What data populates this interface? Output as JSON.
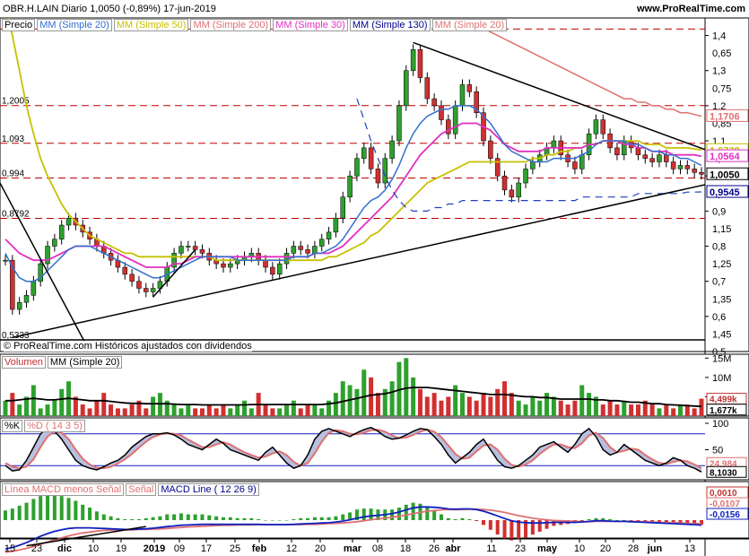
{
  "header": {
    "title": "OBR.H.LAIN  Diario  1,0050 (-0,89%)  17-jun-2019",
    "site": "www.ProRealTime.com"
  },
  "legend_price": [
    "Precio",
    "MM (Simple 20)",
    "MM (Simple 50)",
    "MM (Simple 200)",
    "MM (Simple 30)",
    "MM (Simple 130)",
    "MM (Simple 20)"
  ],
  "legend_colors": [
    "#000000",
    "#3070d0",
    "#c8c000",
    "#e07070",
    "#e030c0",
    "#00008b",
    "#e07070"
  ],
  "legend_volume": [
    "Volumen",
    "MM (Simple 20)"
  ],
  "legend_stoch": [
    "%K",
    "%D ( 14 3 5)"
  ],
  "legend_macd": [
    "Línea MACD menos Señal",
    "Señal",
    "MACD Line ( 12 26 9)"
  ],
  "credit": "© ProRealTime.com Históricos ajustados con dividendos",
  "chart_data": [
    {
      "type": "candlestick",
      "name": "price",
      "ylim": [
        0.5,
        1.45
      ],
      "y_ticks": [
        0.5,
        0.6,
        0.7,
        0.8,
        0.9,
        1.0,
        1.1,
        1.2,
        1.3,
        1.4
      ],
      "y_tick_labels": [
        "0,5",
        "0,6",
        "0,7",
        "0,8",
        "0,9",
        "1",
        "1,1",
        "1,2",
        "1,3",
        "1,4"
      ],
      "extra_labels": [
        "1,45",
        "1,35",
        "1,25",
        "1,15",
        "1,05",
        "0,95",
        "0,85",
        "0,75",
        "0,65",
        "0,55"
      ],
      "x_labels": [
        "15",
        "23",
        "dic",
        "10",
        "19",
        "2019",
        "09",
        "17",
        "25",
        "feb",
        "12",
        "20",
        "mar",
        "08",
        "18",
        "26",
        "abr",
        "11",
        "23",
        "may",
        "10",
        "20",
        "28",
        "jun",
        "13"
      ],
      "hlines": [
        {
          "value": 1.4185,
          "label": "1,4185"
        },
        {
          "value": 1.2005,
          "label": "1,2005"
        },
        {
          "value": 1.093,
          "label": "1,093"
        },
        {
          "value": 0.994,
          "label": "0,994"
        },
        {
          "value": 0.8792,
          "label": "0,8792"
        },
        {
          "value": 0.5333,
          "label": "0,5333"
        }
      ],
      "badges": [
        {
          "value": 1.1706,
          "label": "1,1706",
          "color": "#e07070"
        },
        {
          "value": 1.0738,
          "label": "1,0738",
          "color": "#c8c000"
        },
        {
          "value": 1.0564,
          "label": "1,0564",
          "color": "#e030c0"
        },
        {
          "value": 1.005,
          "label": "1,0050",
          "color": "#000000"
        },
        {
          "value": 0.9545,
          "label": "0,9545",
          "color": "#00008b"
        }
      ],
      "close": [
        0.76,
        0.62,
        0.64,
        0.66,
        0.7,
        0.75,
        0.8,
        0.82,
        0.86,
        0.88,
        0.86,
        0.84,
        0.82,
        0.8,
        0.78,
        0.76,
        0.74,
        0.72,
        0.7,
        0.68,
        0.67,
        0.68,
        0.7,
        0.74,
        0.78,
        0.8,
        0.8,
        0.79,
        0.78,
        0.76,
        0.75,
        0.74,
        0.75,
        0.76,
        0.77,
        0.78,
        0.76,
        0.74,
        0.72,
        0.75,
        0.78,
        0.8,
        0.79,
        0.78,
        0.8,
        0.82,
        0.84,
        0.88,
        0.94,
        1.0,
        1.05,
        1.08,
        1.02,
        0.98,
        1.05,
        1.1,
        1.2,
        1.3,
        1.36,
        1.28,
        1.22,
        1.2,
        1.16,
        1.12,
        1.2,
        1.26,
        1.24,
        1.18,
        1.1,
        1.05,
        1.0,
        0.96,
        0.94,
        0.98,
        1.02,
        1.04,
        1.06,
        1.08,
        1.1,
        1.06,
        1.04,
        1.02,
        1.06,
        1.12,
        1.16,
        1.12,
        1.08,
        1.06,
        1.1,
        1.08,
        1.06,
        1.05,
        1.04,
        1.06,
        1.04,
        1.02,
        1.03,
        1.02,
        1.01,
        1.005
      ],
      "sma20": [
        0.78,
        0.74,
        0.71,
        0.7,
        0.7,
        0.71,
        0.73,
        0.75,
        0.77,
        0.79,
        0.8,
        0.8,
        0.8,
        0.79,
        0.78,
        0.77,
        0.76,
        0.75,
        0.74,
        0.73,
        0.72,
        0.71,
        0.71,
        0.72,
        0.73,
        0.74,
        0.75,
        0.76,
        0.77,
        0.77,
        0.77,
        0.77,
        0.77,
        0.76,
        0.76,
        0.76,
        0.76,
        0.76,
        0.76,
        0.76,
        0.76,
        0.77,
        0.77,
        0.77,
        0.78,
        0.78,
        0.79,
        0.8,
        0.82,
        0.85,
        0.88,
        0.91,
        0.93,
        0.94,
        0.96,
        0.99,
        1.03,
        1.08,
        1.12,
        1.15,
        1.17,
        1.18,
        1.19,
        1.19,
        1.2,
        1.2,
        1.2,
        1.19,
        1.17,
        1.15,
        1.12,
        1.09,
        1.07,
        1.06,
        1.05,
        1.04,
        1.04,
        1.04,
        1.05,
        1.05,
        1.05,
        1.05,
        1.06,
        1.07,
        1.09,
        1.1,
        1.1,
        1.1,
        1.1,
        1.09,
        1.09,
        1.08,
        1.07,
        1.07,
        1.06,
        1.06,
        1.05,
        1.05,
        1.04,
        1.03
      ],
      "sma30": [
        0.82,
        0.8,
        0.78,
        0.77,
        0.76,
        0.76,
        0.76,
        0.77,
        0.78,
        0.79,
        0.8,
        0.8,
        0.8,
        0.8,
        0.8,
        0.79,
        0.78,
        0.77,
        0.76,
        0.75,
        0.74,
        0.74,
        0.74,
        0.74,
        0.75,
        0.75,
        0.76,
        0.77,
        0.77,
        0.77,
        0.77,
        0.77,
        0.77,
        0.77,
        0.77,
        0.77,
        0.77,
        0.77,
        0.77,
        0.77,
        0.77,
        0.77,
        0.77,
        0.77,
        0.78,
        0.78,
        0.78,
        0.79,
        0.8,
        0.82,
        0.84,
        0.86,
        0.88,
        0.9,
        0.92,
        0.94,
        0.97,
        1.0,
        1.03,
        1.06,
        1.08,
        1.1,
        1.12,
        1.13,
        1.14,
        1.15,
        1.15,
        1.15,
        1.14,
        1.13,
        1.11,
        1.09,
        1.08,
        1.07,
        1.07,
        1.07,
        1.07,
        1.08,
        1.08,
        1.08,
        1.08,
        1.08,
        1.08,
        1.09,
        1.09,
        1.1,
        1.1,
        1.1,
        1.09,
        1.09,
        1.08,
        1.08,
        1.07,
        1.07,
        1.07,
        1.06,
        1.06,
        1.06,
        1.06,
        1.056
      ],
      "sma50": [
        1.5,
        1.4,
        1.3,
        1.2,
        1.12,
        1.05,
        1.0,
        0.96,
        0.92,
        0.89,
        0.87,
        0.85,
        0.83,
        0.82,
        0.81,
        0.8,
        0.79,
        0.78,
        0.78,
        0.77,
        0.77,
        0.77,
        0.77,
        0.77,
        0.77,
        0.77,
        0.77,
        0.77,
        0.77,
        0.77,
        0.76,
        0.76,
        0.76,
        0.76,
        0.76,
        0.76,
        0.76,
        0.76,
        0.76,
        0.76,
        0.76,
        0.76,
        0.76,
        0.76,
        0.76,
        0.76,
        0.77,
        0.77,
        0.78,
        0.79,
        0.8,
        0.81,
        0.83,
        0.84,
        0.86,
        0.88,
        0.9,
        0.92,
        0.94,
        0.96,
        0.98,
        0.99,
        1.0,
        1.01,
        1.02,
        1.03,
        1.04,
        1.04,
        1.04,
        1.04,
        1.04,
        1.04,
        1.04,
        1.04,
        1.04,
        1.05,
        1.05,
        1.06,
        1.06,
        1.07,
        1.07,
        1.08,
        1.08,
        1.09,
        1.09,
        1.1,
        1.1,
        1.1,
        1.1,
        1.1,
        1.1,
        1.09,
        1.09,
        1.09,
        1.08,
        1.08,
        1.08,
        1.08,
        1.077,
        1.074
      ],
      "sma200": [
        null,
        null,
        null,
        null,
        null,
        null,
        null,
        null,
        null,
        null,
        null,
        null,
        null,
        null,
        null,
        null,
        null,
        null,
        null,
        null,
        null,
        null,
        null,
        null,
        null,
        null,
        null,
        null,
        null,
        null,
        null,
        null,
        null,
        null,
        null,
        null,
        null,
        null,
        null,
        null,
        null,
        null,
        null,
        null,
        null,
        null,
        null,
        null,
        null,
        null,
        null,
        null,
        null,
        null,
        null,
        null,
        null,
        null,
        null,
        null,
        null,
        null,
        null,
        null,
        null,
        null,
        1.44,
        1.43,
        1.42,
        1.41,
        1.4,
        1.39,
        1.38,
        1.37,
        1.36,
        1.35,
        1.34,
        1.33,
        1.32,
        1.31,
        1.3,
        1.29,
        1.28,
        1.27,
        1.26,
        1.25,
        1.24,
        1.23,
        1.22,
        1.22,
        1.21,
        1.21,
        1.2,
        1.2,
        1.19,
        1.19,
        1.18,
        1.18,
        1.175,
        1.17
      ],
      "sma130": [
        null,
        null,
        null,
        null,
        null,
        null,
        null,
        null,
        null,
        null,
        null,
        null,
        null,
        null,
        null,
        null,
        null,
        null,
        null,
        null,
        null,
        null,
        null,
        null,
        null,
        null,
        null,
        null,
        null,
        null,
        null,
        null,
        null,
        null,
        null,
        null,
        null,
        null,
        null,
        null,
        null,
        null,
        null,
        null,
        null,
        null,
        null,
        null,
        null,
        null,
        1.22,
        1.16,
        1.1,
        1.05,
        1.0,
        0.96,
        0.93,
        0.91,
        0.9,
        0.9,
        0.9,
        0.91,
        0.91,
        0.92,
        0.92,
        0.93,
        0.93,
        0.93,
        0.93,
        0.93,
        0.93,
        0.93,
        0.93,
        0.93,
        0.93,
        0.93,
        0.93,
        0.93,
        0.93,
        0.93,
        0.93,
        0.93,
        0.94,
        0.94,
        0.94,
        0.94,
        0.94,
        0.94,
        0.94,
        0.94,
        0.95,
        0.95,
        0.95,
        0.95,
        0.95,
        0.95,
        0.95,
        0.954,
        0.954,
        0.9545
      ]
    },
    {
      "type": "bar",
      "name": "volume",
      "ylim": [
        0,
        16000000
      ],
      "y_tick_labels": [
        "15M",
        "10M",
        "5M"
      ],
      "badges": [
        "4,499k",
        "1,677k"
      ],
      "values": [
        4,
        6,
        3,
        5,
        8,
        2,
        3,
        4,
        7,
        9,
        5,
        3,
        2,
        4,
        6,
        3,
        2,
        2,
        3,
        4,
        2,
        5,
        6,
        4,
        3,
        2,
        3,
        2,
        2,
        3,
        2,
        3,
        2,
        3,
        4,
        2,
        6,
        3,
        2,
        2,
        3,
        4,
        2,
        3,
        3,
        2,
        4,
        6,
        9,
        8,
        7,
        12,
        10,
        6,
        7,
        9,
        14,
        15,
        10,
        7,
        5,
        6,
        4,
        5,
        8,
        6,
        5,
        4,
        6,
        5,
        7,
        9,
        6,
        4,
        3,
        5,
        4,
        6,
        5,
        4,
        3,
        4,
        8,
        6,
        5,
        3,
        4,
        3,
        4,
        3,
        3,
        4,
        3,
        2,
        3,
        2,
        3,
        3,
        2,
        4.5
      ],
      "sma20": [
        4,
        4,
        4.2,
        4.4,
        4.6,
        4.4,
        4.2,
        4.2,
        4.4,
        4.6,
        4.4,
        4.2,
        4,
        4,
        4,
        3.8,
        3.6,
        3.4,
        3.3,
        3.3,
        3.2,
        3.2,
        3.2,
        3.2,
        3.1,
        3,
        3,
        3,
        2.9,
        2.9,
        2.9,
        2.9,
        2.9,
        2.9,
        2.9,
        3,
        3,
        3,
        3,
        3,
        3,
        3,
        3,
        3,
        3,
        3,
        3.2,
        3.4,
        3.8,
        4.2,
        4.6,
        5,
        5.4,
        5.6,
        5.8,
        6.2,
        6.8,
        7.2,
        7.4,
        7.4,
        7.4,
        7.2,
        7,
        6.8,
        6.6,
        6.4,
        6.2,
        6,
        5.8,
        5.6,
        5.6,
        5.6,
        5.4,
        5.2,
        5,
        5,
        4.8,
        4.8,
        4.6,
        4.4,
        4.4,
        4.4,
        4.4,
        4.4,
        4.2,
        4.2,
        4,
        4,
        3.8,
        3.6,
        3.6,
        3.4,
        3.2,
        3.2,
        3,
        2.9,
        2.8,
        2.7,
        2.6,
        2.5
      ]
    },
    {
      "type": "line",
      "name": "stochastic",
      "ylim": [
        0,
        100
      ],
      "y_tick_labels": [
        "100",
        "50"
      ],
      "badges": [
        "24,984",
        "8,1030"
      ],
      "k": [
        20,
        10,
        12,
        30,
        55,
        80,
        92,
        85,
        70,
        50,
        30,
        20,
        15,
        12,
        18,
        25,
        30,
        40,
        55,
        65,
        75,
        80,
        80,
        82,
        78,
        70,
        60,
        55,
        50,
        60,
        70,
        62,
        50,
        45,
        40,
        35,
        30,
        45,
        55,
        40,
        25,
        15,
        20,
        40,
        70,
        85,
        90,
        85,
        80,
        75,
        82,
        88,
        92,
        85,
        75,
        70,
        72,
        78,
        85,
        90,
        88,
        75,
        60,
        40,
        25,
        35,
        45,
        60,
        70,
        50,
        30,
        18,
        15,
        20,
        30,
        40,
        55,
        60,
        65,
        55,
        45,
        60,
        80,
        90,
        75,
        50,
        40,
        45,
        60,
        50,
        40,
        30,
        25,
        20,
        25,
        35,
        30,
        20,
        15,
        8
      ],
      "d": [
        25,
        18,
        15,
        18,
        32,
        55,
        75,
        85,
        82,
        70,
        50,
        33,
        22,
        16,
        15,
        18,
        24,
        32,
        42,
        54,
        65,
        74,
        79,
        81,
        80,
        77,
        69,
        62,
        55,
        55,
        60,
        64,
        60,
        52,
        45,
        40,
        35,
        37,
        43,
        47,
        40,
        27,
        20,
        25,
        43,
        65,
        82,
        87,
        85,
        80,
        79,
        82,
        87,
        88,
        84,
        77,
        72,
        73,
        78,
        84,
        88,
        84,
        74,
        58,
        42,
        33,
        35,
        47,
        58,
        60,
        50,
        33,
        21,
        18,
        22,
        30,
        42,
        52,
        60,
        60,
        55,
        53,
        62,
        77,
        82,
        72,
        55,
        45,
        48,
        52,
        50,
        40,
        32,
        25,
        23,
        27,
        30,
        28,
        22,
        15
      ]
    },
    {
      "type": "line",
      "name": "macd",
      "badges": [
        "0,0010",
        "-0,0107",
        "-0,0156"
      ],
      "macd": [
        -0.09,
        -0.085,
        -0.078,
        -0.07,
        -0.06,
        -0.05,
        -0.042,
        -0.035,
        -0.03,
        -0.026,
        -0.024,
        -0.024,
        -0.024,
        -0.025,
        -0.026,
        -0.027,
        -0.028,
        -0.029,
        -0.029,
        -0.028,
        -0.027,
        -0.025,
        -0.023,
        -0.02,
        -0.018,
        -0.016,
        -0.015,
        -0.014,
        -0.013,
        -0.013,
        -0.013,
        -0.013,
        -0.013,
        -0.013,
        -0.013,
        -0.013,
        -0.013,
        -0.014,
        -0.014,
        -0.014,
        -0.014,
        -0.013,
        -0.012,
        -0.011,
        -0.01,
        -0.009,
        -0.008,
        -0.006,
        -0.003,
        0.001,
        0.006,
        0.01,
        0.013,
        0.015,
        0.017,
        0.02,
        0.025,
        0.032,
        0.038,
        0.041,
        0.041,
        0.04,
        0.038,
        0.035,
        0.034,
        0.035,
        0.035,
        0.033,
        0.028,
        0.021,
        0.013,
        0.005,
        -0.002,
        -0.006,
        -0.008,
        -0.009,
        -0.009,
        -0.008,
        -0.007,
        -0.007,
        -0.007,
        -0.007,
        -0.006,
        -0.004,
        -0.002,
        -0.002,
        -0.003,
        -0.004,
        -0.004,
        -0.005,
        -0.006,
        -0.007,
        -0.008,
        -0.009,
        -0.01,
        -0.011,
        -0.012,
        -0.013,
        -0.014,
        -0.0156
      ],
      "signal": [
        -0.1,
        -0.097,
        -0.093,
        -0.088,
        -0.082,
        -0.075,
        -0.068,
        -0.061,
        -0.055,
        -0.049,
        -0.044,
        -0.04,
        -0.037,
        -0.034,
        -0.032,
        -0.031,
        -0.03,
        -0.03,
        -0.03,
        -0.029,
        -0.029,
        -0.028,
        -0.027,
        -0.026,
        -0.024,
        -0.023,
        -0.021,
        -0.02,
        -0.019,
        -0.018,
        -0.017,
        -0.016,
        -0.016,
        -0.015,
        -0.015,
        -0.015,
        -0.014,
        -0.014,
        -0.014,
        -0.014,
        -0.014,
        -0.014,
        -0.014,
        -0.013,
        -0.013,
        -0.012,
        -0.011,
        -0.01,
        -0.009,
        -0.007,
        -0.005,
        -0.002,
        0.001,
        0.004,
        0.006,
        0.009,
        0.012,
        0.016,
        0.02,
        0.024,
        0.028,
        0.03,
        0.032,
        0.033,
        0.033,
        0.033,
        0.034,
        0.034,
        0.033,
        0.031,
        0.028,
        0.024,
        0.019,
        0.014,
        0.01,
        0.006,
        0.003,
        0.001,
        -0.001,
        -0.002,
        -0.003,
        -0.004,
        -0.005,
        -0.005,
        -0.004,
        -0.004,
        -0.004,
        -0.004,
        -0.004,
        -0.004,
        -0.005,
        -0.005,
        -0.006,
        -0.007,
        -0.008,
        -0.008,
        -0.009,
        -0.01,
        -0.011,
        -0.0107
      ]
    }
  ]
}
